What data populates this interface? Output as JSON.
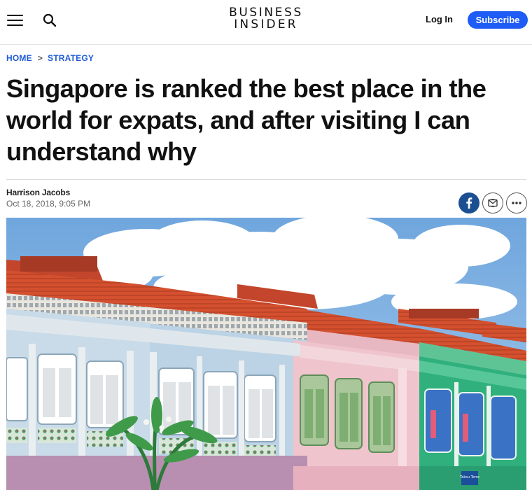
{
  "header": {
    "logo_line1": "BUSINESS",
    "logo_line2": "INSIDER",
    "login_label": "Log In",
    "subscribe_label": "Subscribe",
    "icons": [
      "menu-icon",
      "search-icon"
    ]
  },
  "breadcrumb": {
    "items": [
      "HOME",
      "STRATEGY"
    ],
    "separator": ">"
  },
  "article": {
    "headline": "Singapore is ranked the best place in the world for expats, and after visiting I can understand why",
    "author": "Harrison Jacobs",
    "date": "Oct 18, 2018, 9:05 PM"
  },
  "share": {
    "icons": [
      "facebook-icon",
      "email-icon",
      "more-icon"
    ]
  },
  "hero_image": {
    "subject": "colorful shophouses",
    "small_sign_text": "Taksu Terre"
  },
  "colors": {
    "accent": "#1e5cf5",
    "breadcrumb": "#1f5bd6",
    "facebook": "#1b4f91"
  }
}
